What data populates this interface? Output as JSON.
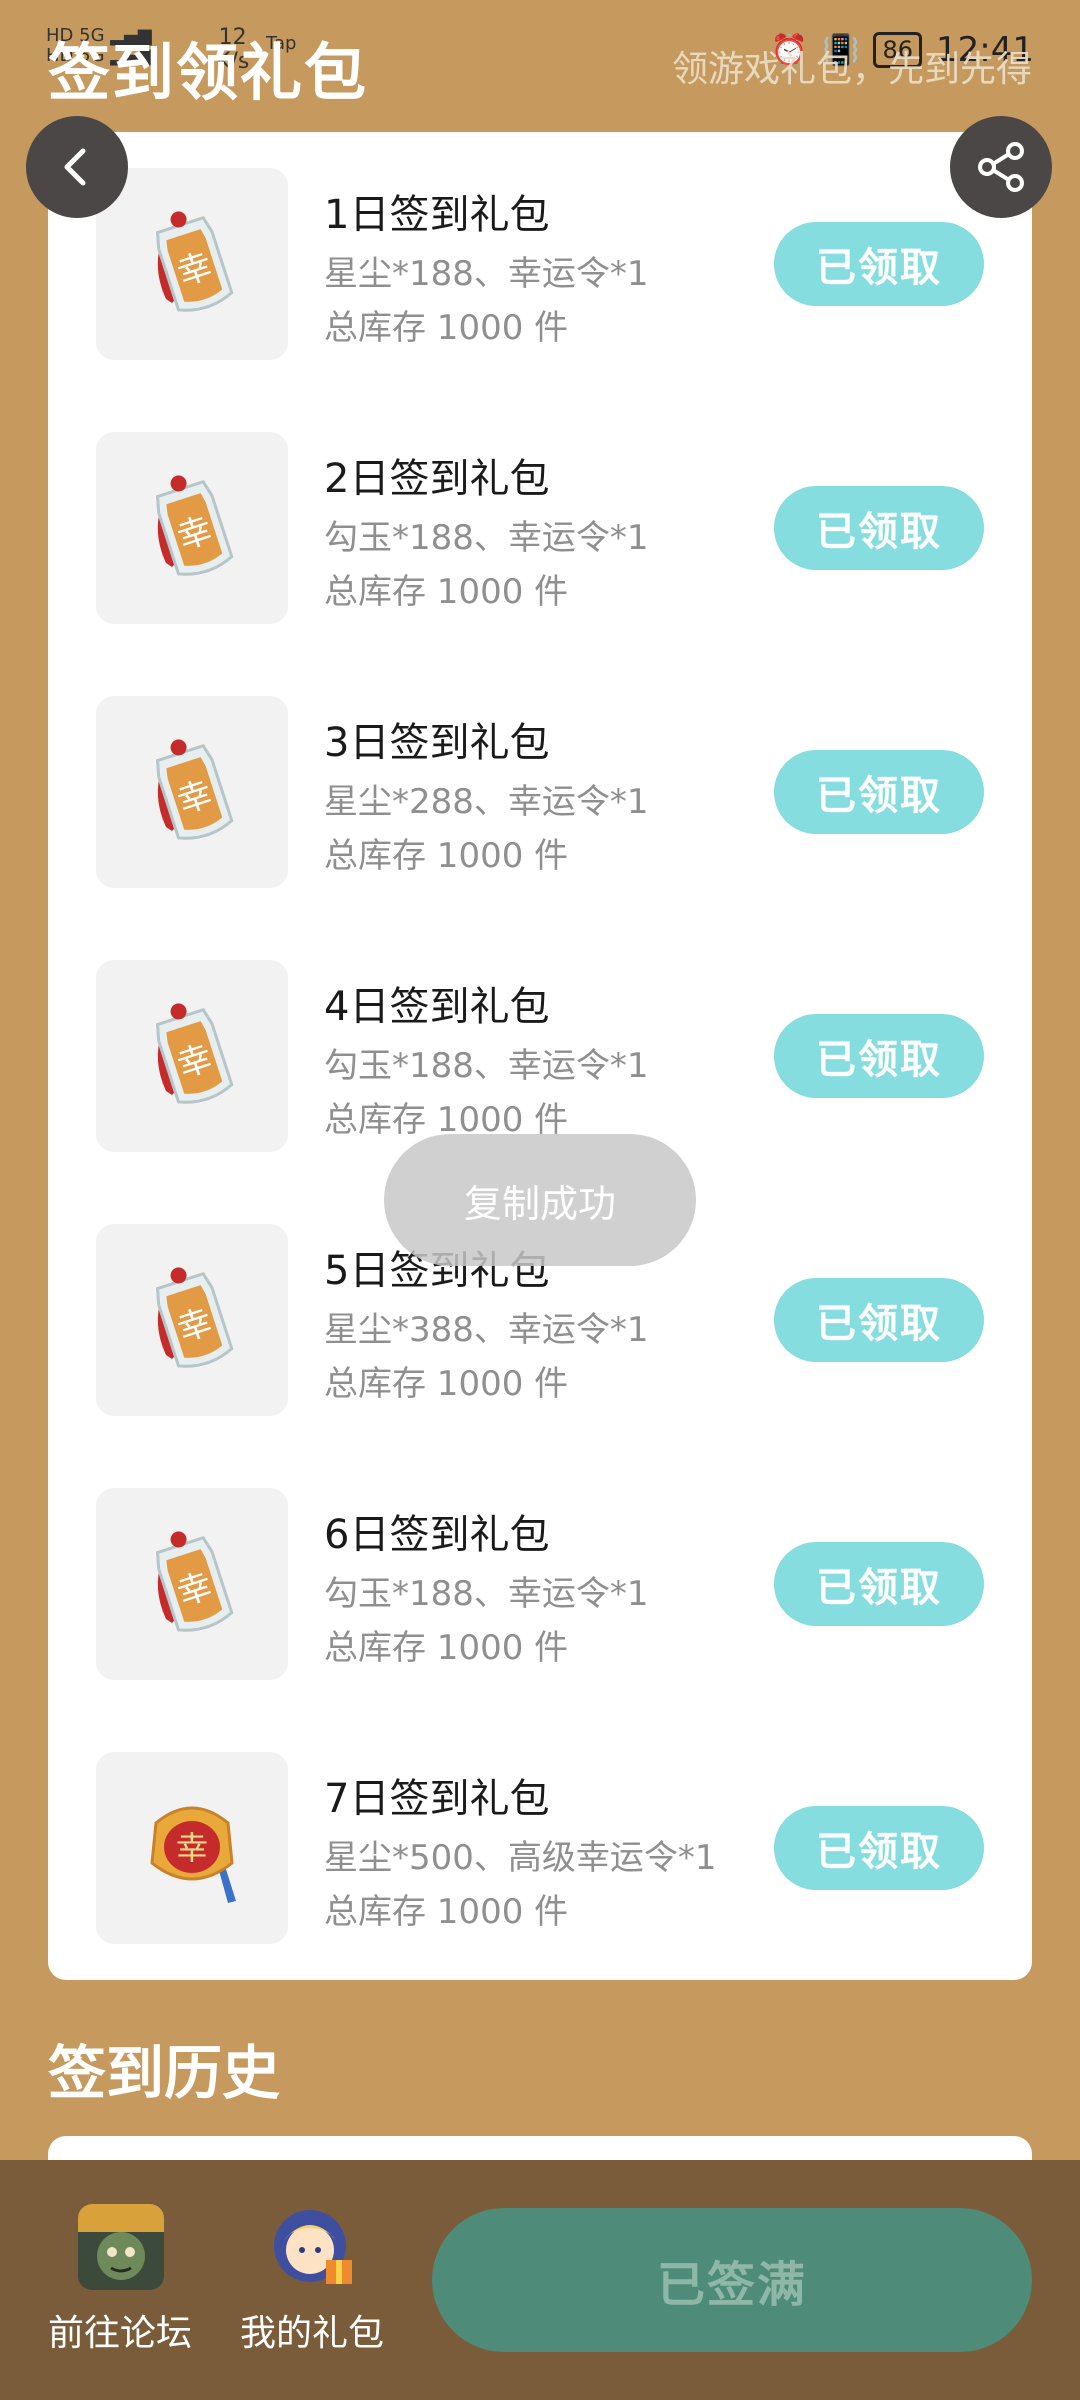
{
  "status_bar": {
    "left_signal": "HD 5G | HD 5G",
    "speed": "12\nK/s",
    "app_label": "Tap",
    "battery": "86",
    "time": "12:41"
  },
  "header": {
    "title": "签到领礼包",
    "subtitle": "领游戏礼包，先到先得"
  },
  "gifts": [
    {
      "title": "1日签到礼包",
      "desc": "星尘*188、幸运令*1",
      "stock": "总库存 1000 件",
      "button": "已领取",
      "icon": "lucky-token-icon"
    },
    {
      "title": "2日签到礼包",
      "desc": "勾玉*188、幸运令*1",
      "stock": "总库存 1000 件",
      "button": "已领取",
      "icon": "lucky-token-icon"
    },
    {
      "title": "3日签到礼包",
      "desc": "星尘*288、幸运令*1",
      "stock": "总库存 1000 件",
      "button": "已领取",
      "icon": "lucky-token-icon"
    },
    {
      "title": "4日签到礼包",
      "desc": "勾玉*188、幸运令*1",
      "stock": "总库存 1000 件",
      "button": "已领取",
      "icon": "lucky-token-icon"
    },
    {
      "title": "5日签到礼包",
      "desc": "星尘*388、幸运令*1",
      "stock": "总库存 1000 件",
      "button": "已领取",
      "icon": "lucky-token-icon"
    },
    {
      "title": "6日签到礼包",
      "desc": "勾玉*188、幸运令*1",
      "stock": "总库存 1000 件",
      "button": "已领取",
      "icon": "lucky-token-icon"
    },
    {
      "title": "7日签到礼包",
      "desc": "星尘*500、高级幸运令*1",
      "stock": "总库存 1000 件",
      "button": "已领取",
      "icon": "premium-lucky-token-icon"
    }
  ],
  "toast": "复制成功",
  "history": {
    "title": "签到历史"
  },
  "bottom_bar": {
    "forum_label": "前往论坛",
    "my_gifts_label": "我的礼包",
    "signed_button": "已签满"
  },
  "colors": {
    "background": "#c69a5e",
    "claim_button": "#86dde0",
    "signed_button": "#4e8b78",
    "bottom_bar": "#7a5c3a"
  }
}
